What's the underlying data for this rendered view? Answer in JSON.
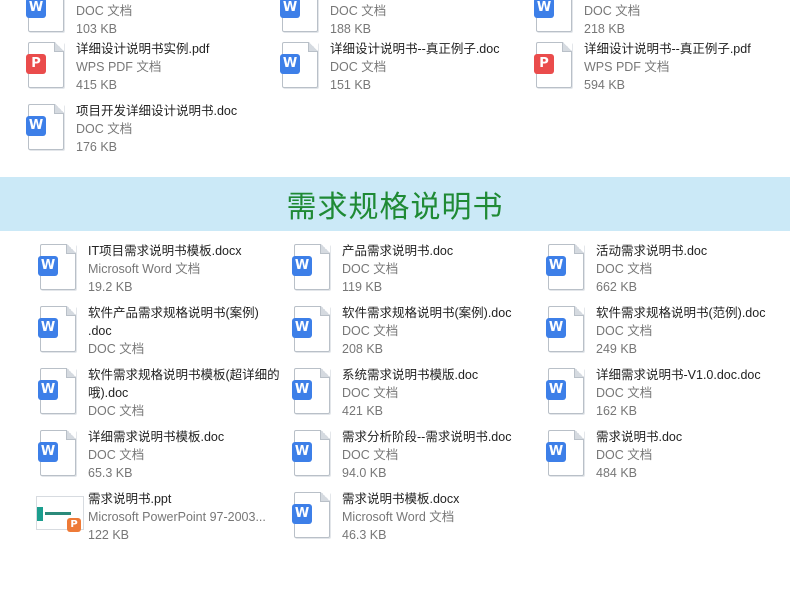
{
  "top_section": {
    "files": [
      {
        "name": "",
        "type": "DOC 文档",
        "size": "103 KB",
        "kind": "word"
      },
      {
        "name": "",
        "type": "DOC 文档",
        "size": "188 KB",
        "kind": "word"
      },
      {
        "name": "",
        "type": "DOC 文档",
        "size": "218 KB",
        "kind": "word"
      },
      {
        "name": "详细设计说明书实例.pdf",
        "type": "WPS PDF 文档",
        "size": "415 KB",
        "kind": "pdf"
      },
      {
        "name": "详细设计说明书--真正例子.doc",
        "type": "DOC 文档",
        "size": "151 KB",
        "kind": "word"
      },
      {
        "name": "详细设计说明书--真正例子.pdf",
        "type": "WPS PDF 文档",
        "size": "594 KB",
        "kind": "pdf"
      },
      {
        "name": "项目开发详细设计说明书.doc",
        "type": "DOC 文档",
        "size": "176 KB",
        "kind": "word"
      }
    ]
  },
  "banner": {
    "title": "需求规格说明书"
  },
  "requirements_section": {
    "files": [
      {
        "name": "IT项目需求说明书模板.docx",
        "type": "Microsoft Word 文档",
        "size": "19.2 KB",
        "kind": "word"
      },
      {
        "name": "产品需求说明书.doc",
        "type": "DOC 文档",
        "size": "119 KB",
        "kind": "word"
      },
      {
        "name": "活动需求说明书.doc",
        "type": "DOC 文档",
        "size": "662 KB",
        "kind": "word"
      },
      {
        "name": "软件产品需求规格说明书(案例)",
        "name2": ".doc",
        "type": "DOC 文档",
        "size": "",
        "kind": "word"
      },
      {
        "name": "软件需求规格说明书(案例).doc",
        "type": "DOC 文档",
        "size": "208 KB",
        "kind": "word"
      },
      {
        "name": "软件需求规格说明书(范例).doc",
        "type": "DOC 文档",
        "size": "249 KB",
        "kind": "word"
      },
      {
        "name": "软件需求规格说明书模板(超详细的",
        "name2": "哦).doc",
        "type": "DOC 文档",
        "size": "",
        "kind": "word"
      },
      {
        "name": "系统需求说明书模版.doc",
        "type": "DOC 文档",
        "size": "421 KB",
        "kind": "word"
      },
      {
        "name": "详细需求说明书-V1.0.doc.doc",
        "type": "DOC 文档",
        "size": "162 KB",
        "kind": "word"
      },
      {
        "name": "详细需求说明书模板.doc",
        "type": "DOC 文档",
        "size": "65.3 KB",
        "kind": "word"
      },
      {
        "name": "需求分析阶段--需求说明书.doc",
        "type": "DOC 文档",
        "size": "94.0 KB",
        "kind": "word"
      },
      {
        "name": "需求说明书.doc",
        "type": "DOC 文档",
        "size": "484 KB",
        "kind": "word"
      },
      {
        "name": "需求说明书.ppt",
        "type": "Microsoft PowerPoint 97-2003...",
        "size": "122 KB",
        "kind": "ppt"
      },
      {
        "name": "需求说明书模板.docx",
        "type": "Microsoft Word 文档",
        "size": "46.3 KB",
        "kind": "word"
      }
    ]
  },
  "icons": {
    "word_glyph": "W",
    "pdf_glyph": "P",
    "ppt_glyph": "P"
  },
  "colors": {
    "word": "#3d7fe8",
    "pdf": "#ea4c4c",
    "ppt": "#ee7a37",
    "banner_bg": "#cbe9f7",
    "banner_text": "#1f8a35"
  }
}
